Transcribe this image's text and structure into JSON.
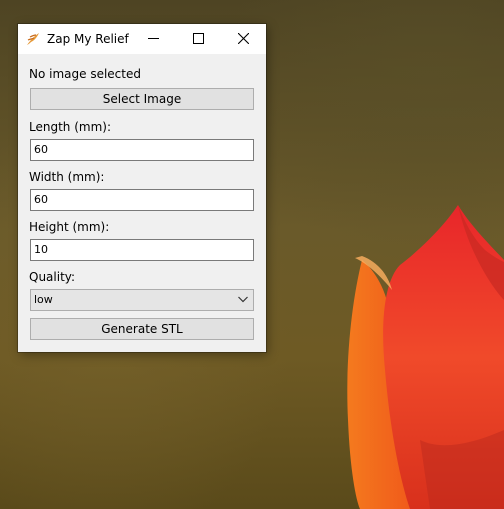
{
  "window": {
    "title": "Zap My Relief",
    "icon": "feather-icon"
  },
  "titlebar": {
    "minimize_icon": "minimize-icon",
    "maximize_icon": "maximize-icon",
    "close_icon": "close-icon"
  },
  "form": {
    "status": "No image selected",
    "select_button": "Select Image",
    "length_label": "Length (mm):",
    "length_value": "60",
    "width_label": "Width (mm):",
    "width_value": "60",
    "height_label": "Height (mm):",
    "height_value": "10",
    "quality_label": "Quality:",
    "quality_value": "low",
    "generate_button": "Generate STL"
  },
  "colors": {
    "window_bg": "#f0f0f0",
    "titlebar_bg": "#ffffff",
    "button_bg": "#e1e1e1",
    "tulip_red": "#e8321a",
    "tulip_orange": "#f4701e"
  }
}
